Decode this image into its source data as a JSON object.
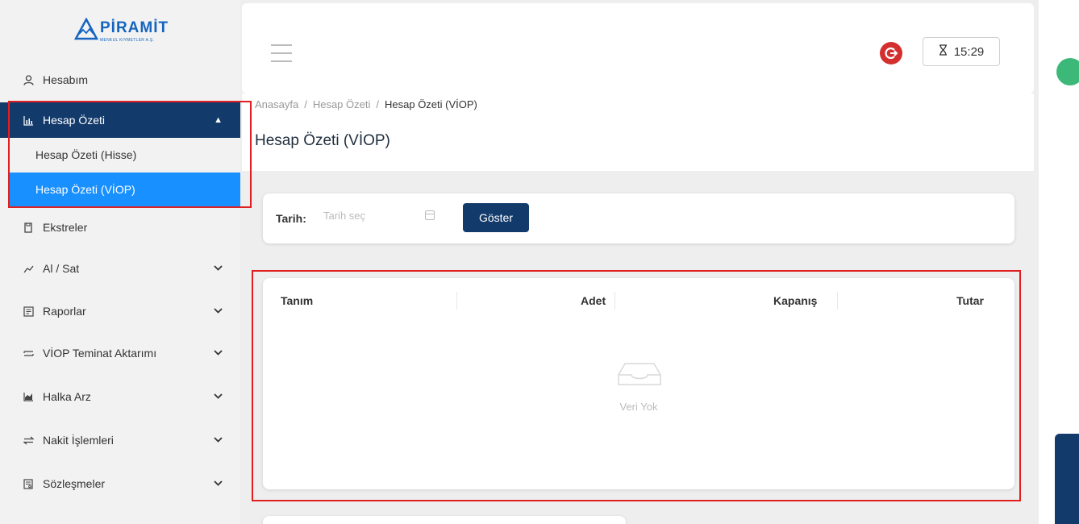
{
  "brand": {
    "name": "PİRAMİT",
    "subtitle": "MENKUL KIYMETLER A.Ş."
  },
  "sidebar": {
    "items": [
      {
        "label": "Hesabım",
        "icon": "user-icon"
      },
      {
        "label": "Hesap Özeti",
        "icon": "bar-chart-icon",
        "expanded": true,
        "children": [
          {
            "label": "Hesap Özeti (Hisse)"
          },
          {
            "label": "Hesap Özeti (VİOP)",
            "active": true
          }
        ]
      },
      {
        "label": "Ekstreler",
        "icon": "document-icon"
      },
      {
        "label": "Al / Sat",
        "icon": "trend-icon"
      },
      {
        "label": "Raporlar",
        "icon": "report-icon"
      },
      {
        "label": "VİOP Teminat Aktarımı",
        "icon": "transfer-icon"
      },
      {
        "label": "Halka Arz",
        "icon": "area-chart-icon"
      },
      {
        "label": "Nakit İşlemleri",
        "icon": "exchange-icon"
      },
      {
        "label": "Sözleşmeler",
        "icon": "contract-icon"
      }
    ]
  },
  "header": {
    "timer": "15:29"
  },
  "breadcrumb": [
    "Anasayfa",
    "Hesap Özeti",
    "Hesap Özeti (VİOP)"
  ],
  "page": {
    "title": "Hesap Özeti (VİOP)"
  },
  "filter": {
    "label": "Tarih:",
    "placeholder": "Tarih seç",
    "button": "Göster"
  },
  "table": {
    "columns": [
      "Tanım",
      "Adet",
      "Kapanış",
      "Tutar"
    ],
    "empty_text": "Veri Yok"
  },
  "colors": {
    "primary": "#123a6b",
    "active": "#1890ff",
    "highlight": "#e02020",
    "logout": "#d32f2f",
    "brand": "#1565c0"
  }
}
